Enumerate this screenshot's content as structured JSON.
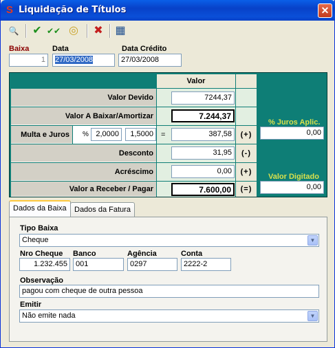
{
  "window": {
    "title": "Liquidação de Títulos",
    "close_glyph": "✕"
  },
  "toolbar": [
    {
      "name": "search-icon",
      "glyph": "🔍",
      "color": "#1E4AA8"
    },
    {
      "name": "check-icon",
      "glyph": "✔",
      "color": "#1C8F1C"
    },
    {
      "name": "double-check-icon",
      "glyph": "✔✔",
      "color": "#1C8F1C"
    },
    {
      "name": "coins-icon",
      "glyph": "◎",
      "color": "#C9A227"
    },
    {
      "name": "cancel-x-icon",
      "glyph": "✖",
      "color": "#C41E1E"
    },
    {
      "name": "calculator-icon",
      "glyph": "▦",
      "color": "#1F4F8F"
    }
  ],
  "header": {
    "baixa_label": "Baixa",
    "baixa_value": "1",
    "data_label": "Data",
    "data_value": "27/03/2008",
    "data_credito_label": "Data Crédito",
    "data_credito_value": "27/03/2008"
  },
  "values": {
    "column_header": "Valor",
    "valor_devido_label": "Valor Devido",
    "valor_devido": "7244,37",
    "valor_baixar_label": "Valor A Baixar/Amortizar",
    "valor_baixar": "7.244,37",
    "multa_label": "Multa e Juros",
    "percent_sign": "%",
    "multa_pct": "2,0000",
    "juros_pct": "1,5000",
    "equals": "=",
    "multa_valor": "387,58",
    "multa_sign": "(+)",
    "desconto_label": "Desconto",
    "desconto": "31,95",
    "desconto_sign": "(-)",
    "acrescimo_label": "Acréscimo",
    "acrescimo": "0,00",
    "acrescimo_sign": "(+)",
    "receber_label": "Valor a Receber / Pagar",
    "receber": "7.600,00",
    "receber_sign": "(=)",
    "juros_aplic_label": "% Juros Aplic.",
    "juros_aplic": "0,00",
    "valor_digitado_label": "Valor Digitado",
    "valor_digitado": "0,00"
  },
  "tabs": [
    {
      "label": "Dados da Baixa",
      "active": true
    },
    {
      "label": "Dados da Fatura",
      "active": false
    }
  ],
  "baixa_tab": {
    "tipo_label": "Tipo Baixa",
    "tipo_value": "Cheque",
    "nro_cheque_label": "Nro Cheque",
    "nro_cheque": "1.232.455",
    "banco_label": "Banco",
    "banco": "001",
    "agencia_label": "Agência",
    "agencia": "0297",
    "conta_label": "Conta",
    "conta": "2222-2",
    "observacao_label": "Observação",
    "observacao": "pagou com cheque de outra pessoa",
    "emitir_label": "Emitir",
    "emitir_value": "Não emite nada"
  },
  "colors": {
    "title_bar": "#0A5FE8",
    "panel_teal": "#0E7E76",
    "label_red": "#8B0000"
  }
}
